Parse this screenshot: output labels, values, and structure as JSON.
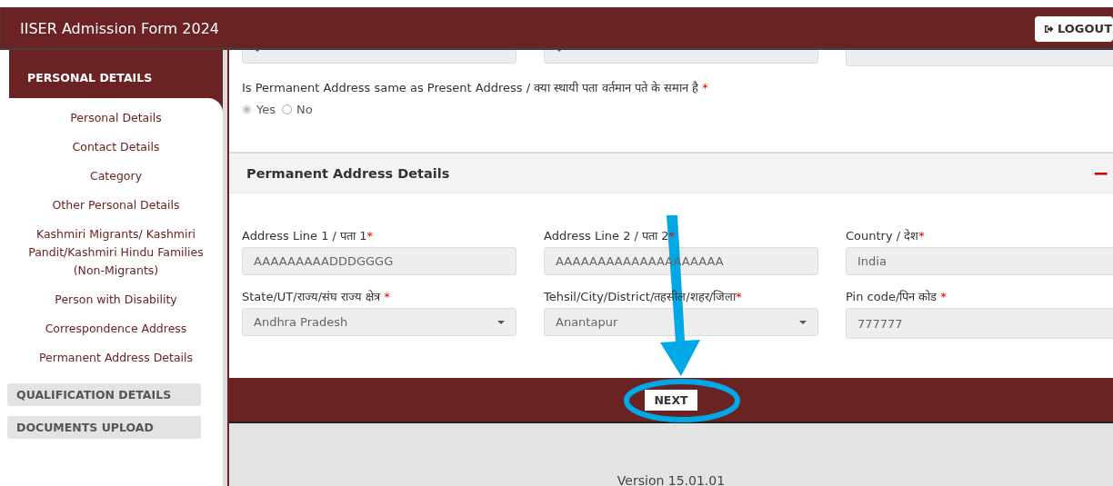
{
  "header": {
    "title": "IISER Admission Form 2024",
    "logout": "LOGOUT"
  },
  "sidebar": {
    "sections": [
      {
        "label": "PERSONAL DETAILS",
        "expanded": true,
        "items": [
          "Personal Details",
          "Contact Details",
          "Category",
          "Other Personal Details",
          "Kashmiri Migrants/ Kashmiri Pandit/Kashmiri Hindu Families (Non-Migrants)",
          "Person with Disability",
          "Correspondence Address",
          "Permanent Address Details"
        ]
      },
      {
        "label": "QUALIFICATION DETAILS",
        "expanded": false
      },
      {
        "label": "DOCUMENTS UPLOAD",
        "expanded": false
      }
    ]
  },
  "previous_row": [
    {
      "kind": "select"
    },
    {
      "kind": "select"
    },
    {
      "kind": "text"
    }
  ],
  "question": {
    "text": "Is Permanent Address same as Present Address / क्या स्थायी पता वर्तमान पते के समान है",
    "required": "*",
    "options": [
      {
        "label": "Yes",
        "selected": true,
        "disabled": true
      },
      {
        "label": "No",
        "selected": false,
        "disabled": false
      }
    ]
  },
  "section": {
    "title": "Permanent Address Details",
    "toggle": "−",
    "fields": [
      {
        "label": "Address Line 1 / पता 1",
        "required": "*",
        "kind": "text",
        "value": "AAAAAAAAADDDGGGG"
      },
      {
        "label": "Address Line 2 / पता 2",
        "required": "*",
        "kind": "text",
        "value": "AAAAAAAAAAAAAAAAAAAA"
      },
      {
        "label": "Country / देश",
        "required": "*",
        "kind": "text",
        "value": "India"
      },
      {
        "label": "State/UT/राज्य/संघ राज्य क्षेत्र ",
        "required": "*",
        "kind": "select",
        "value": "Andhra Pradesh"
      },
      {
        "label": "Tehsil/City/District/तहसील/शहर/जिला",
        "required": "*",
        "kind": "select",
        "value": "Anantapur"
      },
      {
        "label": "Pin code/पिन कोड  ",
        "required": "*",
        "kind": "text",
        "value": "777777"
      }
    ]
  },
  "next_button": "NEXT",
  "footer": {
    "version": "Version 15.01.01"
  }
}
